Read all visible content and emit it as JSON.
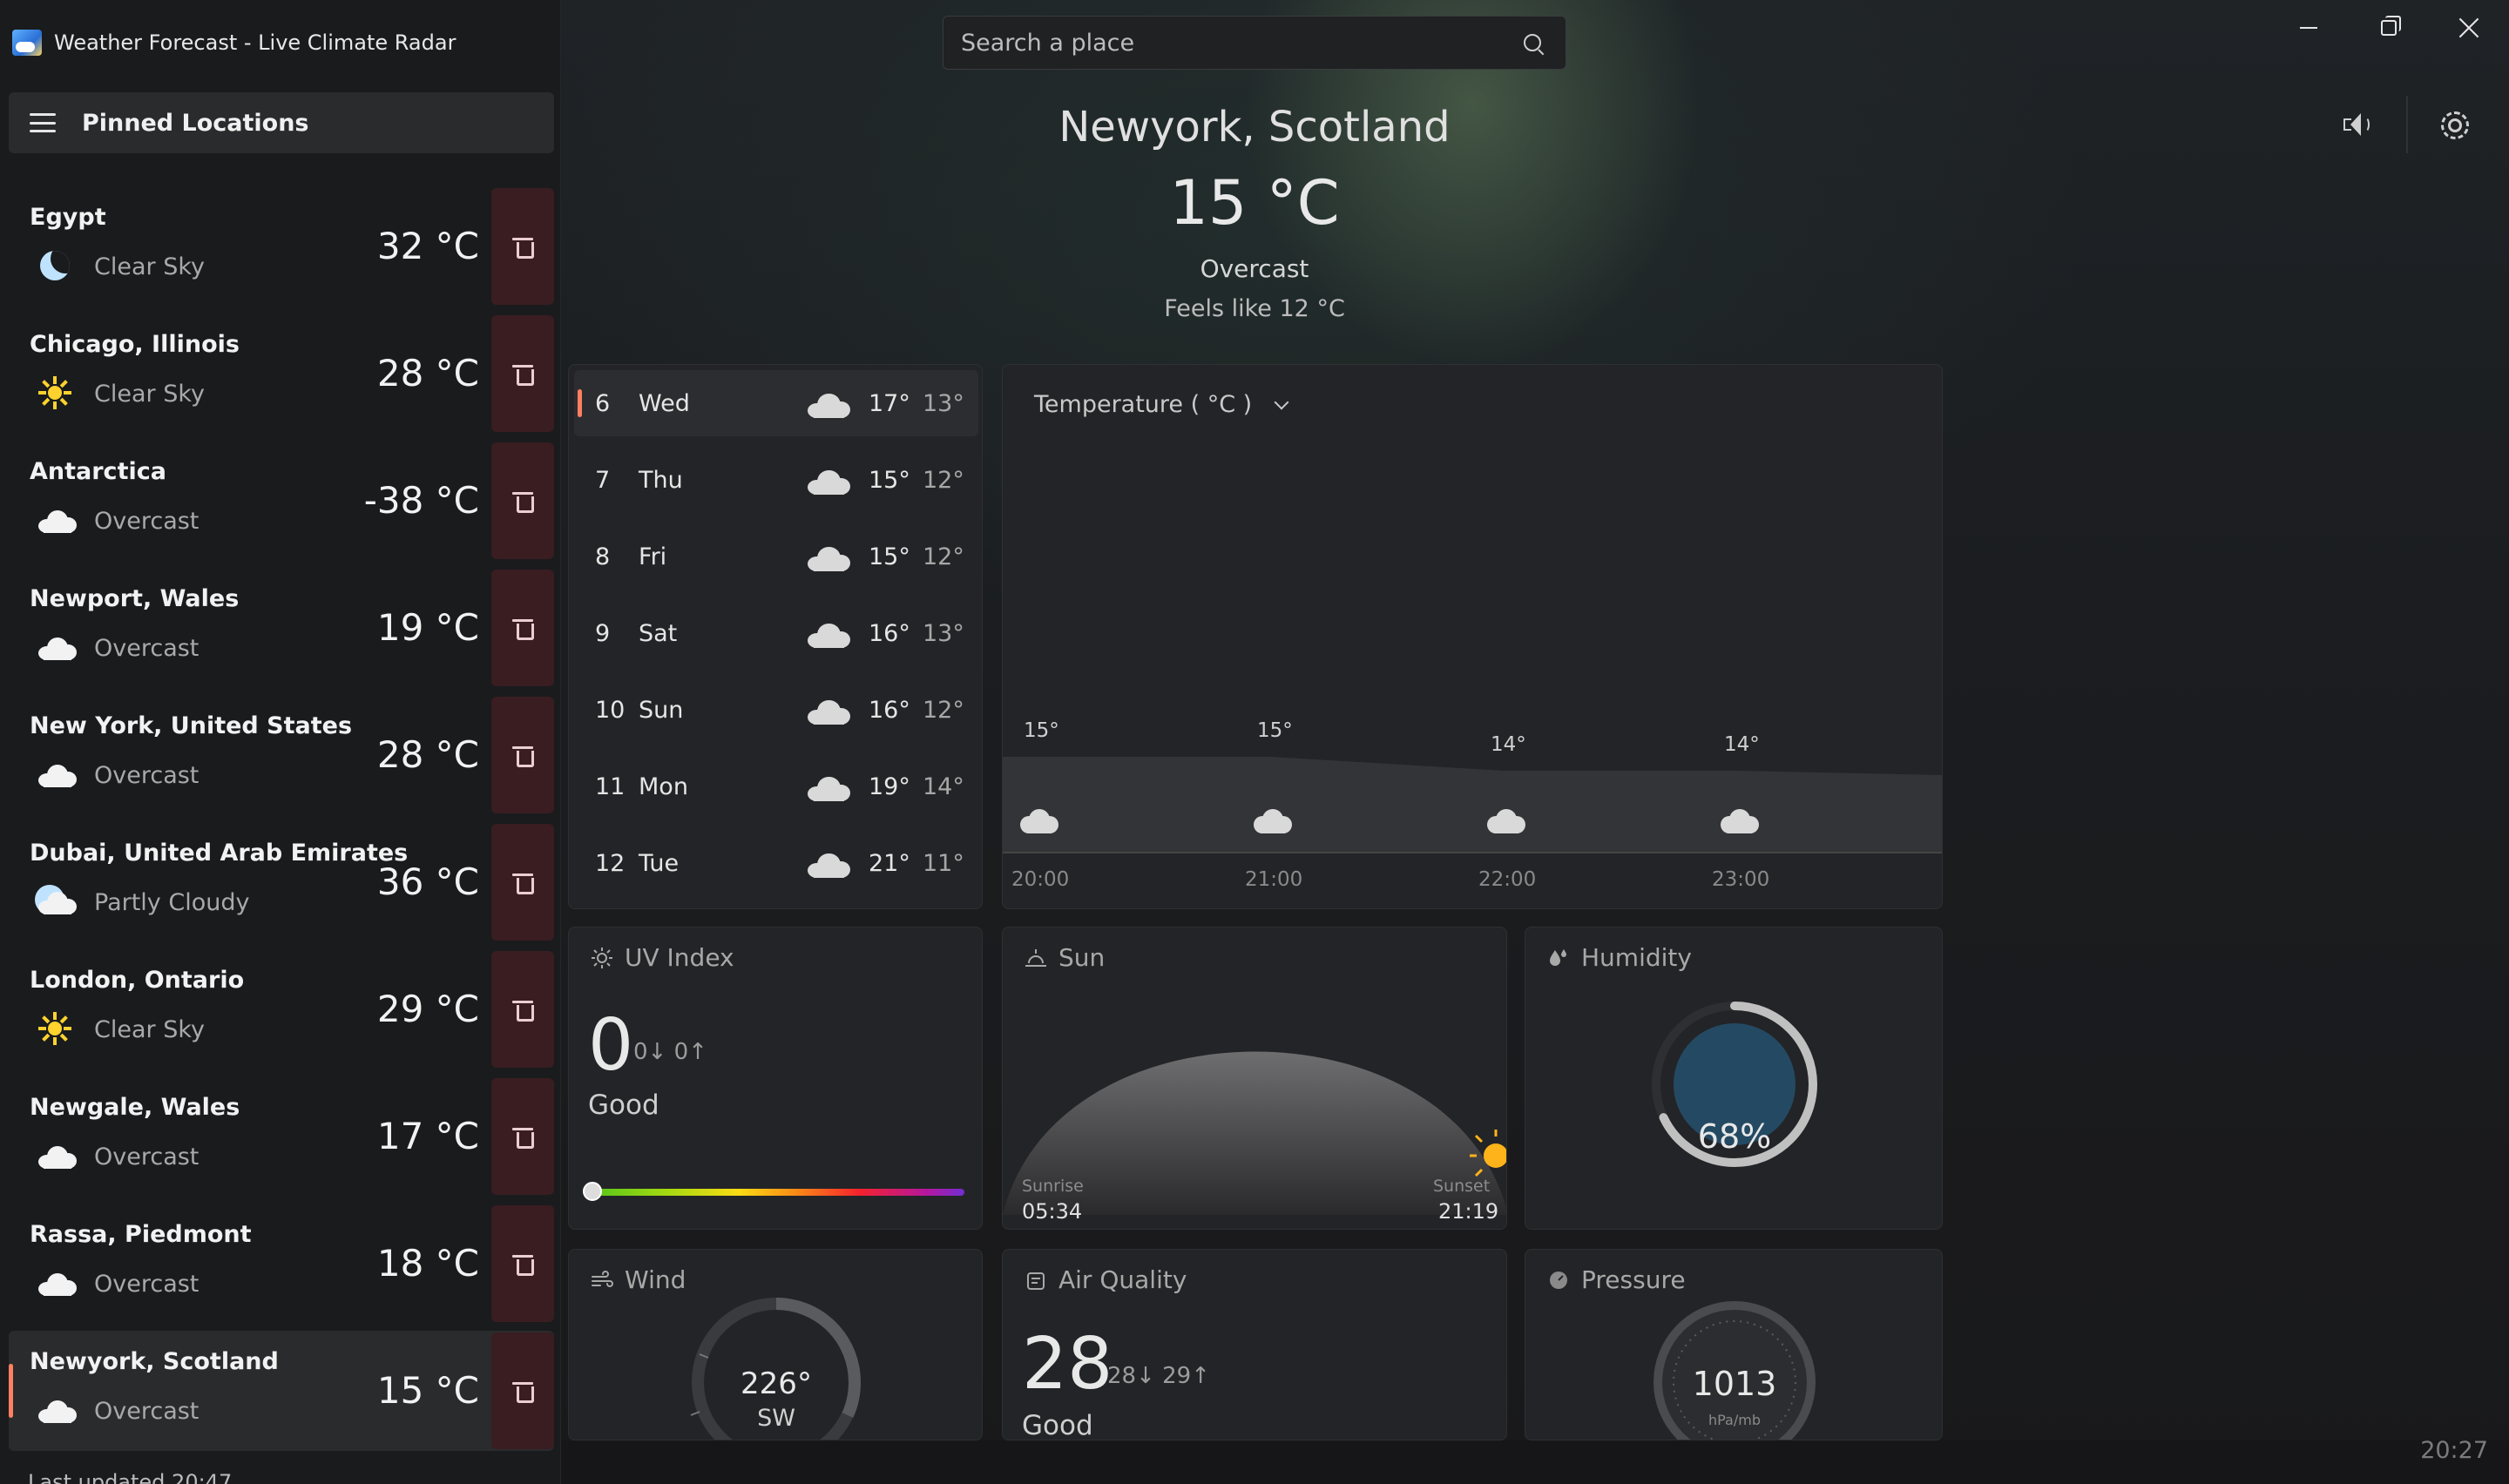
{
  "window": {
    "title": "Weather Forecast - Live Climate Radar"
  },
  "sidebar": {
    "header": "Pinned Locations",
    "locations": [
      {
        "name": "Egypt",
        "condition": "Clear Sky",
        "icon": "moon-icon",
        "temp": "32 °C"
      },
      {
        "name": "Chicago, Illinois",
        "condition": "Clear Sky",
        "icon": "sun-icon",
        "temp": "28 °C"
      },
      {
        "name": "Antarctica",
        "condition": "Overcast",
        "icon": "cloud-icon",
        "temp": "-38 °C"
      },
      {
        "name": "Newport, Wales",
        "condition": "Overcast",
        "icon": "cloud-icon",
        "temp": "19 °C"
      },
      {
        "name": "New York, United States",
        "condition": "Overcast",
        "icon": "cloud-icon",
        "temp": "28 °C"
      },
      {
        "name": "Dubai, United Arab Emirates",
        "condition": "Partly Cloudy",
        "icon": "partly-cloudy-icon",
        "temp": "36 °C"
      },
      {
        "name": "London, Ontario",
        "condition": "Clear Sky",
        "icon": "sun-icon",
        "temp": "29 °C"
      },
      {
        "name": "Newgale, Wales",
        "condition": "Overcast",
        "icon": "cloud-icon",
        "temp": "17 °C"
      },
      {
        "name": "Rassa, Piedmont",
        "condition": "Overcast",
        "icon": "cloud-icon",
        "temp": "18 °C"
      },
      {
        "name": "Newyork, Scotland",
        "condition": "Overcast",
        "icon": "cloud-icon",
        "temp": "15 °C",
        "active": true
      }
    ],
    "last_updated": "Last updated 20:47"
  },
  "search": {
    "placeholder": "Search a place"
  },
  "current": {
    "city": "Newyork, Scotland",
    "temp": "15 °C",
    "condition": "Overcast",
    "feels_like": "Feels like 12 °C"
  },
  "forecast": [
    {
      "day": "6",
      "name": "Wed",
      "high": "17°",
      "low": "13°",
      "active": true
    },
    {
      "day": "7",
      "name": "Thu",
      "high": "15°",
      "low": "12°"
    },
    {
      "day": "8",
      "name": "Fri",
      "high": "15°",
      "low": "12°"
    },
    {
      "day": "9",
      "name": "Sat",
      "high": "16°",
      "low": "13°"
    },
    {
      "day": "10",
      "name": "Sun",
      "high": "16°",
      "low": "12°"
    },
    {
      "day": "11",
      "name": "Mon",
      "high": "19°",
      "low": "14°"
    },
    {
      "day": "12",
      "name": "Tue",
      "high": "21°",
      "low": "11°"
    }
  ],
  "chart": {
    "dropdown_label": "Temperature ( °C )"
  },
  "chart_data": {
    "type": "area",
    "x": [
      "20:00",
      "21:00",
      "22:00",
      "23:00"
    ],
    "values": [
      15,
      15,
      14,
      14
    ],
    "labels": [
      "15°",
      "15°",
      "14°",
      "14°"
    ],
    "ylabel": "Temperature ( °C )"
  },
  "uv": {
    "title": "UV Index",
    "value": "0",
    "range": "0↓ 0↑",
    "level": "Good",
    "index_fraction": 0
  },
  "sun": {
    "title": "Sun",
    "sunrise_label": "Sunrise",
    "sunrise_time": "05:34",
    "sunset_label": "Sunset",
    "sunset_time": "21:19"
  },
  "humidity": {
    "title": "Humidity",
    "value": "68%",
    "fraction": 0.68
  },
  "wind": {
    "title": "Wind",
    "degrees": "226°",
    "direction": "SW"
  },
  "air_quality": {
    "title": "Air Quality",
    "value": "28",
    "range": "28↓ 29↑",
    "level": "Good"
  },
  "pressure": {
    "title": "Pressure",
    "value": "1013",
    "unit": "hPa/mb"
  },
  "clock": "20:27",
  "colors": {
    "accent": "#ff7f61",
    "delete_bg": "#3a1d21",
    "panel_bg": "#232427",
    "humidity_ring": "#c0c0c0",
    "humidity_fill": "#244a63"
  }
}
